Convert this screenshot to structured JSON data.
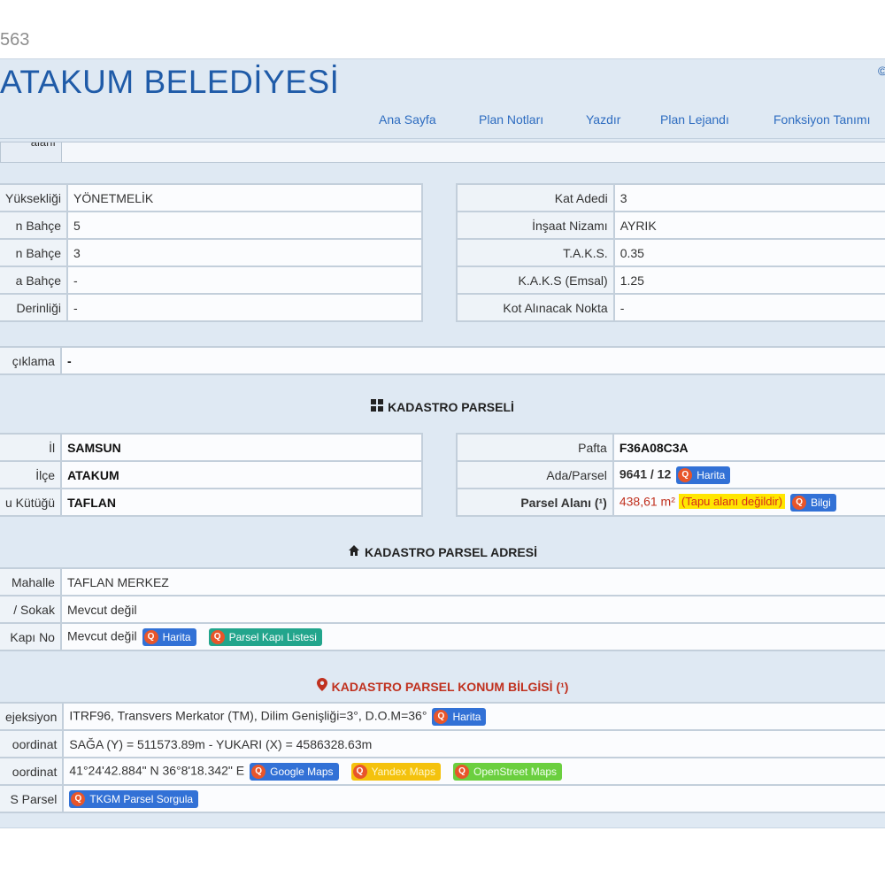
{
  "page_number": "563",
  "header": {
    "title": "ATAKUM BELEDİYESİ",
    "nav": [
      "Ana Sayfa",
      "Plan Notları",
      "Yazdır",
      "Plan Lejandı",
      "Fonksiyon Tanımı"
    ]
  },
  "plan_left": [
    {
      "label": "Yüksekliği",
      "value": "YÖNETMELİK"
    },
    {
      "label": "n Bahçe",
      "value": "5"
    },
    {
      "label": "n Bahçe",
      "value": "3"
    },
    {
      "label": "a Bahçe",
      "value": "-"
    },
    {
      "label": "Derinliği",
      "value": "-"
    }
  ],
  "plan_right": [
    {
      "label": "Kat Adedi",
      "value": "3"
    },
    {
      "label": "İnşaat Nizamı",
      "value": "AYRIK"
    },
    {
      "label": "T.A.K.S.",
      "value": "0.35"
    },
    {
      "label": "K.A.K.S (Emsal)",
      "value": "1.25"
    },
    {
      "label": "Kot Alınacak Nokta",
      "value": "-"
    }
  ],
  "aciklama": {
    "label": "çıklama",
    "value": "-"
  },
  "kadastro": {
    "heading": "KADASTRO PARSELİ",
    "left": [
      {
        "label": "İl",
        "value": "SAMSUN"
      },
      {
        "label": "İlçe",
        "value": "ATAKUM"
      },
      {
        "label": "u Kütüğü",
        "value": "TAFLAN"
      }
    ],
    "pafta_label": "Pafta",
    "pafta_value": "F36A08C3A",
    "ada_label": "Ada/Parsel",
    "ada_value": "9641 / 12",
    "ada_button": "Harita",
    "alan_label": "Parsel Alanı (¹)",
    "alan_value": "438,61 m²",
    "alan_warning": "(Tapu alanı değildir)",
    "alan_button": "Bilgi"
  },
  "adres": {
    "heading": "KADASTRO PARSEL ADRESİ",
    "mahalle_label": "Mahalle",
    "mahalle_value": "TAFLAN MERKEZ",
    "sokak_label": "/ Sokak",
    "sokak_value": "Mevcut değil",
    "kapi_label": "Kapı No",
    "kapi_value": "Mevcut değil",
    "kapi_button1": "Harita",
    "kapi_button2": "Parsel Kapı Listesi"
  },
  "konum": {
    "heading": "KADASTRO PARSEL KONUM BİLGİSİ (¹)",
    "proj_label": "ejeksiyon",
    "proj_value": "ITRF96, Transvers Merkator (TM), Dilim Genişliği=3°, D.O.M=36°",
    "proj_button": "Harita",
    "koord1_label": "oordinat",
    "koord1_value": "SAĞA (Y) = 511573.89m - YUKARI (X) = 4586328.63m",
    "koord2_label": "oordinat",
    "koord2_value": "41°24'42.884\" N 36°8'18.342\" E",
    "google_button": "Google Maps",
    "yandex_button": "Yandex Maps",
    "osm_button": "OpenStreet Maps",
    "tkgm_label": "S Parsel",
    "tkgm_button": "TKGM Parsel Sorgula"
  },
  "colors": {
    "panel": "#dfe9f3",
    "title": "#1f5ba8",
    "link": "#2d6cc0",
    "accent_red": "#c0311f",
    "button_blue": "#3271d6"
  }
}
